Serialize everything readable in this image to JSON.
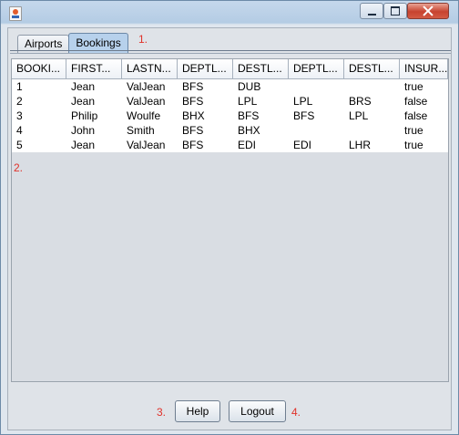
{
  "window": {
    "minimize_icon": "minimize-icon",
    "maximize_icon": "maximize-icon",
    "close_icon": "close-icon"
  },
  "tabs": [
    {
      "label": "Airports",
      "active": false
    },
    {
      "label": "Bookings",
      "active": true
    }
  ],
  "annotations": {
    "a1": "1.",
    "a2": "2.",
    "a3": "3.",
    "a4": "4."
  },
  "table": {
    "headers": [
      "BOOKI...",
      "FIRST...",
      "LASTN...",
      "DEPTL...",
      "DESTL...",
      "DEPTL...",
      "DESTL...",
      "INSUR..."
    ],
    "rows": [
      [
        "1",
        "Jean",
        "ValJean",
        "BFS",
        "DUB",
        "",
        "",
        "true"
      ],
      [
        "2",
        "Jean",
        "ValJean",
        "BFS",
        "LPL",
        "LPL",
        "BRS",
        "false"
      ],
      [
        "3",
        "Philip",
        "Woulfe",
        "BHX",
        "BFS",
        "BFS",
        "LPL",
        "false"
      ],
      [
        "4",
        "John",
        "Smith",
        "BFS",
        "BHX",
        "",
        "",
        "true"
      ],
      [
        "5",
        "Jean",
        "ValJean",
        "BFS",
        "EDI",
        "EDI",
        "LHR",
        "true"
      ]
    ]
  },
  "buttons": {
    "help": "Help",
    "logout": "Logout"
  }
}
